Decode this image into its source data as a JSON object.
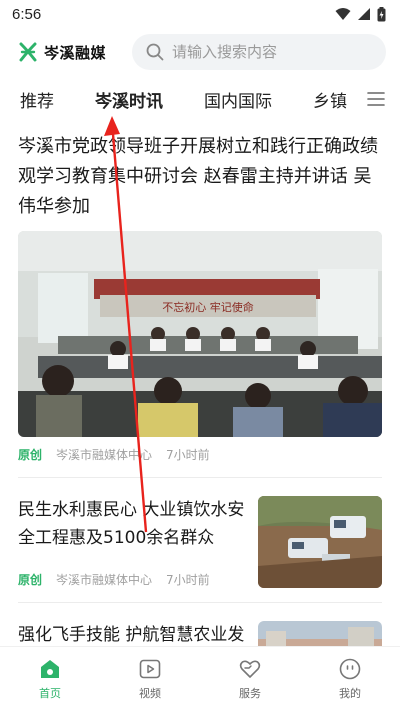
{
  "status": {
    "time": "6:56"
  },
  "header": {
    "logo_text": "岑溪融媒",
    "search_placeholder": "请输入搜索内容"
  },
  "tabs": [
    "推荐",
    "岑溪时讯",
    "国内国际",
    "乡镇"
  ],
  "active_tab": "岑溪时讯",
  "articles": [
    {
      "title": "岑溪市党政领导班子开展树立和践行正确政绩观学习教育集中研讨会 赵春雷主持并讲话 吴伟华参加",
      "tag": "原创",
      "source": "岑溪市融媒体中心",
      "time": "7小时前",
      "banner_text": "不忘初心  牢记使命"
    },
    {
      "title": "民生水利惠民心 大业镇饮水安全工程惠及5100余名群众",
      "tag": "原创",
      "source": "岑溪市融媒体中心",
      "time": "7小时前"
    },
    {
      "title": "强化飞手技能 护航智慧农业发展"
    }
  ],
  "bottom_nav": [
    {
      "label": "首页",
      "icon": "home-icon"
    },
    {
      "label": "视频",
      "icon": "video-icon"
    },
    {
      "label": "服务",
      "icon": "service-heart-icon"
    },
    {
      "label": "我的",
      "icon": "profile-icon"
    }
  ],
  "colors": {
    "accent": "#2db36a",
    "text": "#1a1a1a",
    "meta": "#a0a0a0"
  }
}
